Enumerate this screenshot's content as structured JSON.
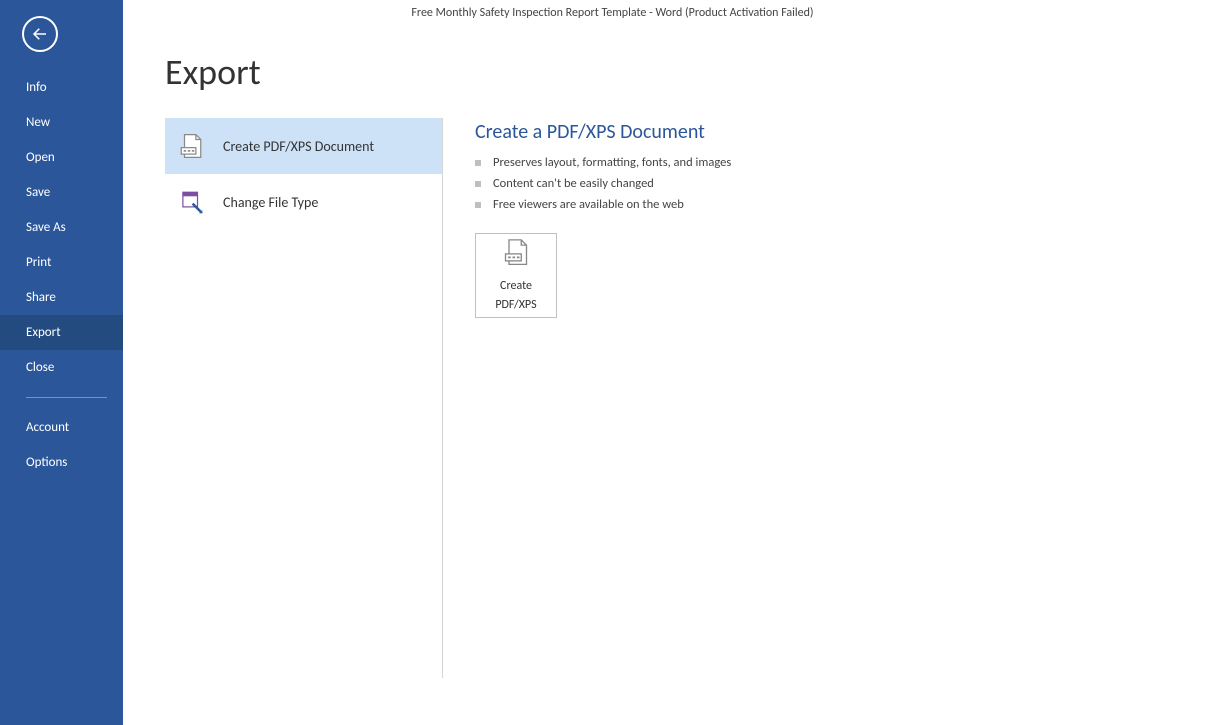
{
  "titlebar": {
    "text": "Free Monthly Safety Inspection Report Template - Word (Product Activation Failed)"
  },
  "sidebar": {
    "items": [
      {
        "label": "Info"
      },
      {
        "label": "New"
      },
      {
        "label": "Open"
      },
      {
        "label": "Save"
      },
      {
        "label": "Save As"
      },
      {
        "label": "Print"
      },
      {
        "label": "Share"
      },
      {
        "label": "Export"
      },
      {
        "label": "Close"
      }
    ],
    "footer": [
      {
        "label": "Account"
      },
      {
        "label": "Options"
      }
    ]
  },
  "page": {
    "title": "Export"
  },
  "options": [
    {
      "label": "Create PDF/XPS Document"
    },
    {
      "label": "Change File Type"
    }
  ],
  "detail": {
    "title": "Create a PDF/XPS Document",
    "bullets": [
      "Preserves layout, formatting, fonts, and images",
      "Content can't be easily changed",
      "Free viewers are available on the web"
    ],
    "button": {
      "line1": "Create",
      "line2": "PDF/XPS"
    }
  }
}
